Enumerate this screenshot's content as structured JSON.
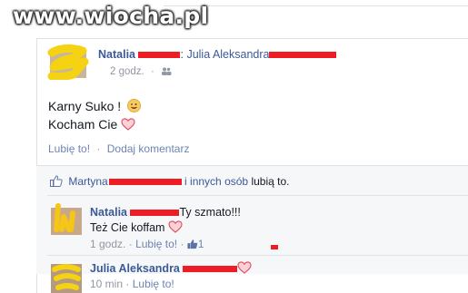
{
  "watermark": "www.wiocha.pl",
  "post": {
    "author": "Natalia",
    "arrow": ":",
    "recipient": "Julia Aleksandra",
    "time": "2 godz.",
    "audience_icon": "friends-icon",
    "lines": [
      "Karny Suko !",
      "Kocham Cie"
    ],
    "like_label": "Lubię to!",
    "separator": "·",
    "comment_label": "Dodaj komentarz"
  },
  "likes": {
    "name": "Martyna",
    "others": "i innych osób",
    "suffix": "lubią to."
  },
  "comments": [
    {
      "author": "Natalia",
      "text_line1": "Ty szmato!!!",
      "text_line2": "Też Cie koffam",
      "time": "1 godz.",
      "separator": "·",
      "like_label": "Lubię to!",
      "like_count": "1"
    },
    {
      "author": "Julia Aleksandra",
      "time": "10 min",
      "separator": "·",
      "like_label": "Lubię to!"
    }
  ],
  "colors": {
    "link_blue": "#3b5998",
    "action_blue": "#6d84b4",
    "meta_grey": "#9197a3",
    "redaction_red": "#ee1c24",
    "scribble_yellow": "#f5d313",
    "heart_pink": "#f07c8c"
  }
}
